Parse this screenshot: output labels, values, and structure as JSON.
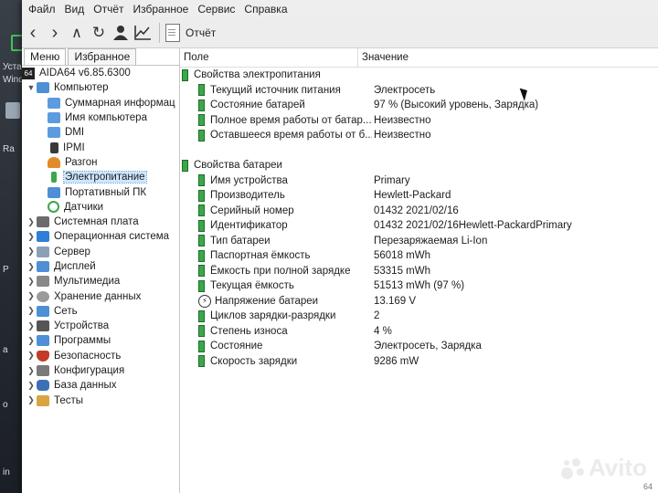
{
  "desktop": {
    "texts": [
      "Уста",
      "Wind",
      "Ra",
      "P",
      "a",
      "o",
      "in"
    ]
  },
  "menu": {
    "items": [
      "Файл",
      "Вид",
      "Отчёт",
      "Избранное",
      "Сервис",
      "Справка"
    ]
  },
  "toolbar": {
    "report_label": "Отчёт"
  },
  "left_tabs": [
    "Меню",
    "Избранное"
  ],
  "tree": {
    "root": "AIDA64 v6.85.6300",
    "computer": "Компьютер",
    "computer_children": [
      "Суммарная информац",
      "Имя компьютера",
      "DMI",
      "IPMI",
      "Разгон",
      "Электропитание",
      "Портативный ПК",
      "Датчики"
    ],
    "categories": [
      "Системная плата",
      "Операционная система",
      "Сервер",
      "Дисплей",
      "Мультимедиа",
      "Хранение данных",
      "Сеть",
      "Устройства",
      "Программы",
      "Безопасность",
      "Конфигурация",
      "База данных",
      "Тесты"
    ]
  },
  "columns": {
    "field": "Поле",
    "value": "Значение"
  },
  "power_section": {
    "title": "Свойства электропитания",
    "rows": [
      {
        "field": "Текущий источник питания",
        "value": "Электросеть"
      },
      {
        "field": "Состояние батарей",
        "value": "97 % (Высокий уровень, Зарядка)"
      },
      {
        "field": "Полное время работы от батар...",
        "value": "Неизвестно"
      },
      {
        "field": "Оставшееся время работы от б...",
        "value": "Неизвестно"
      }
    ]
  },
  "battery_section": {
    "title": "Свойства батареи",
    "rows": [
      {
        "field": "Имя устройства",
        "value": "Primary"
      },
      {
        "field": "Производитель",
        "value": "Hewlett-Packard"
      },
      {
        "field": "Серийный номер",
        "value": "01432 2021/02/16"
      },
      {
        "field": "Идентификатор",
        "value": "01432 2021/02/16Hewlett-PackardPrimary"
      },
      {
        "field": "Тип батареи",
        "value": "Перезаряжаемая Li-Ion"
      },
      {
        "field": "Паспортная ёмкость",
        "value": "56018 mWh"
      },
      {
        "field": "Ёмкость при полной зарядке",
        "value": "53315 mWh"
      },
      {
        "field": "Текущая ёмкость",
        "value": "51513 mWh  (97 %)"
      },
      {
        "field": "Напряжение батареи",
        "value": "13.169 V"
      },
      {
        "field": "Циклов зарядки-разрядки",
        "value": "2"
      },
      {
        "field": "Степень износа",
        "value": "4 %"
      },
      {
        "field": "Состояние",
        "value": "Электросеть, Зарядка"
      },
      {
        "field": "Скорость зарядки",
        "value": "9286 mW"
      }
    ]
  },
  "watermark": {
    "text": "Avito",
    "page": "64"
  },
  "colors": {
    "selection": "#cde6ff",
    "battery_green": "#3aa84a"
  }
}
